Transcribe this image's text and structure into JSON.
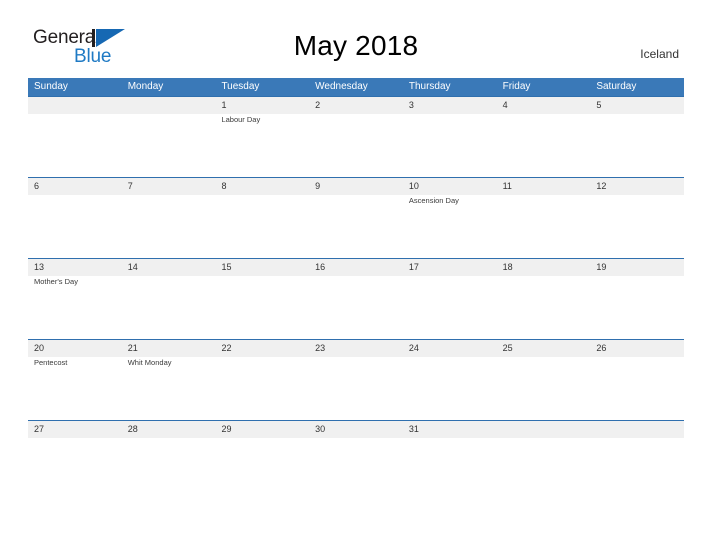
{
  "brand": {
    "name_part1": "General",
    "name_part2": "Blue"
  },
  "header": {
    "title": "May 2018",
    "country": "Iceland"
  },
  "calendar": {
    "weekday_headers": [
      "Sunday",
      "Monday",
      "Tuesday",
      "Wednesday",
      "Thursday",
      "Friday",
      "Saturday"
    ],
    "colors": {
      "header_blue": "#3a79b8",
      "divider_blue": "#2f6fae",
      "date_band_gray": "#f0f0f0",
      "brand_blue": "#1f7ac4",
      "text_dark": "#333333"
    },
    "weeks": [
      [
        {
          "date": "",
          "event": ""
        },
        {
          "date": "",
          "event": ""
        },
        {
          "date": "1",
          "event": "Labour Day"
        },
        {
          "date": "2",
          "event": ""
        },
        {
          "date": "3",
          "event": ""
        },
        {
          "date": "4",
          "event": ""
        },
        {
          "date": "5",
          "event": ""
        }
      ],
      [
        {
          "date": "6",
          "event": ""
        },
        {
          "date": "7",
          "event": ""
        },
        {
          "date": "8",
          "event": ""
        },
        {
          "date": "9",
          "event": ""
        },
        {
          "date": "10",
          "event": "Ascension Day"
        },
        {
          "date": "11",
          "event": ""
        },
        {
          "date": "12",
          "event": ""
        }
      ],
      [
        {
          "date": "13",
          "event": "Mother's Day"
        },
        {
          "date": "14",
          "event": ""
        },
        {
          "date": "15",
          "event": ""
        },
        {
          "date": "16",
          "event": ""
        },
        {
          "date": "17",
          "event": ""
        },
        {
          "date": "18",
          "event": ""
        },
        {
          "date": "19",
          "event": ""
        }
      ],
      [
        {
          "date": "20",
          "event": "Pentecost"
        },
        {
          "date": "21",
          "event": "Whit Monday"
        },
        {
          "date": "22",
          "event": ""
        },
        {
          "date": "23",
          "event": ""
        },
        {
          "date": "24",
          "event": ""
        },
        {
          "date": "25",
          "event": ""
        },
        {
          "date": "26",
          "event": ""
        }
      ],
      [
        {
          "date": "27",
          "event": ""
        },
        {
          "date": "28",
          "event": ""
        },
        {
          "date": "29",
          "event": ""
        },
        {
          "date": "30",
          "event": ""
        },
        {
          "date": "31",
          "event": ""
        },
        {
          "date": "",
          "event": ""
        },
        {
          "date": "",
          "event": ""
        }
      ]
    ]
  }
}
